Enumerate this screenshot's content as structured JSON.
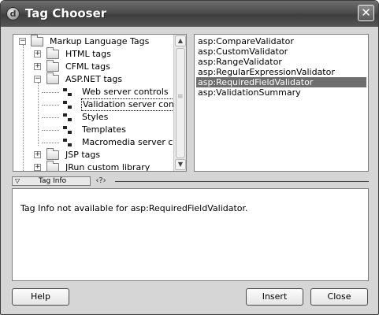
{
  "window": {
    "title": "Tag Chooser",
    "close_glyph": "✕"
  },
  "tree": {
    "rows": [
      {
        "label": "Markup Language Tags",
        "expander": "−",
        "icon": "folder-icon"
      },
      {
        "label": "HTML tags",
        "expander": "+",
        "icon": "folder-icon"
      },
      {
        "label": "CFML tags",
        "expander": "+",
        "icon": "folder-icon"
      },
      {
        "label": "ASP.NET tags",
        "expander": "−",
        "icon": "folder-icon"
      },
      {
        "label": "Web server controls",
        "icon": "tag-icon"
      },
      {
        "label": "Validation server con...",
        "icon": "tag-icon",
        "focused": true
      },
      {
        "label": "Styles",
        "icon": "tag-icon"
      },
      {
        "label": "Templates",
        "icon": "tag-icon"
      },
      {
        "label": "Macromedia server c...",
        "icon": "tag-icon"
      },
      {
        "label": "JSP tags",
        "expander": "+",
        "icon": "folder-icon"
      },
      {
        "label": "JRun custom library",
        "expander": "+",
        "icon": "folder-icon"
      }
    ]
  },
  "tag_list": {
    "items": [
      "asp:CompareValidator",
      "asp:CustomValidator",
      "asp:RangeValidator",
      "asp:RegularExpressionValidator",
      "asp:RequiredFieldValidator",
      "asp:ValidationSummary"
    ],
    "selected_index": 4
  },
  "tag_info": {
    "label": "Tag Info",
    "help_glyph": "‹?›",
    "message": "Tag Info not available for asp:RequiredFieldValidator."
  },
  "buttons": {
    "help": "Help",
    "insert": "Insert",
    "close": "Close"
  },
  "colors": {
    "selection": "#6e6e6e",
    "title_bar": "#4c4c4c"
  }
}
